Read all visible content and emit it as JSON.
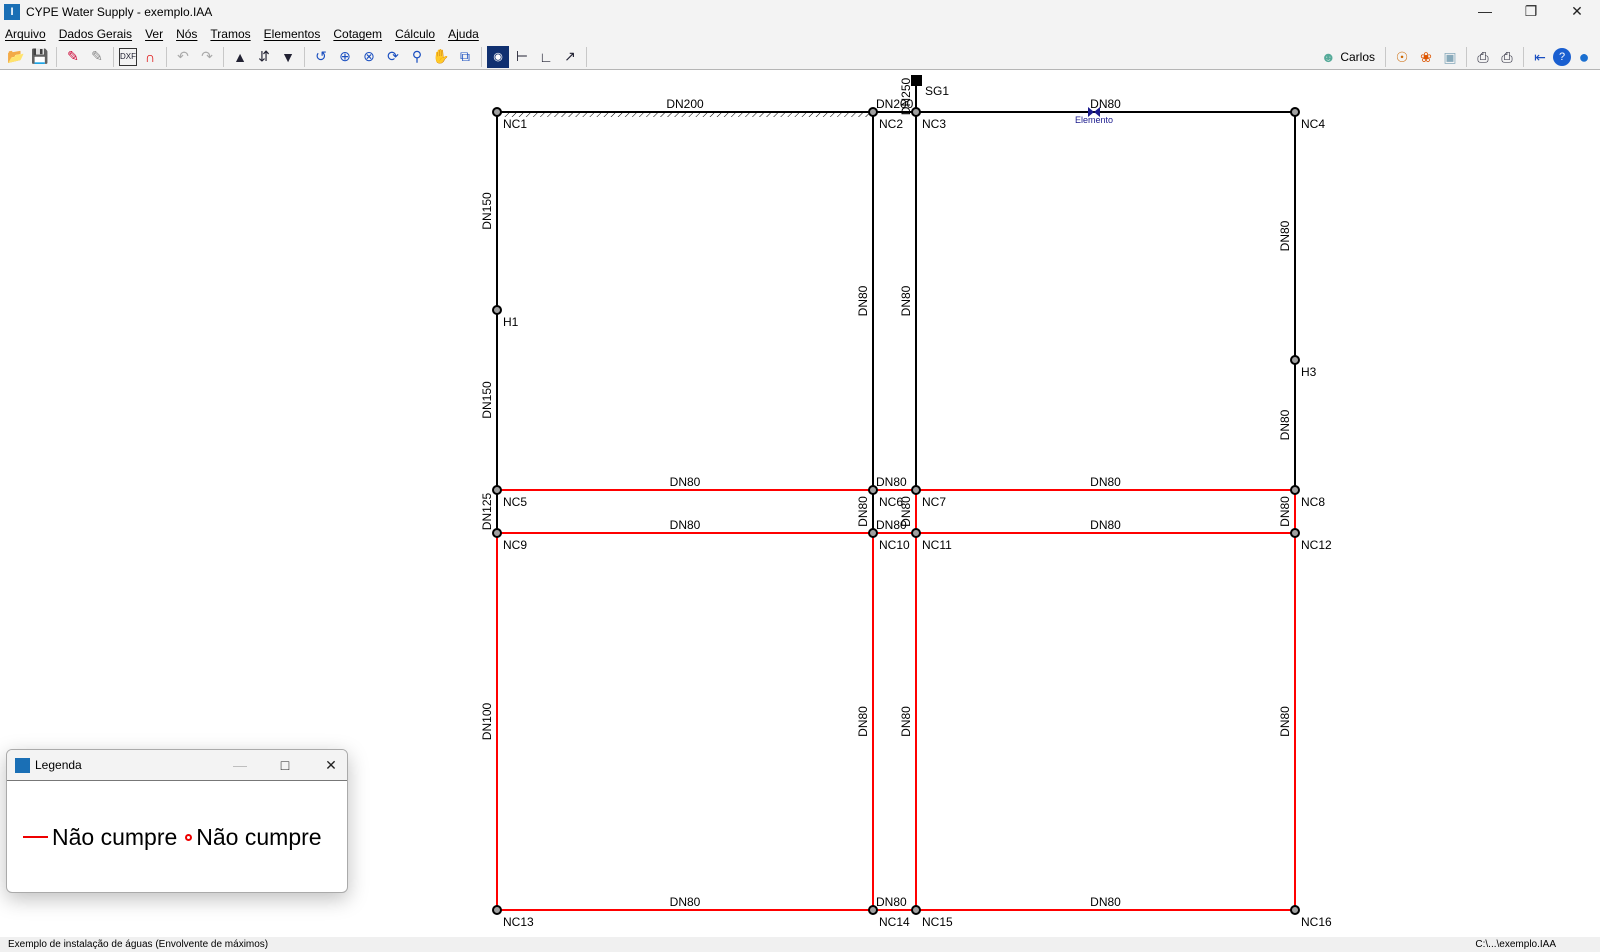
{
  "window": {
    "title": "CYPE Water Supply - exemplo.IAA"
  },
  "menu": [
    "Arquivo",
    "Dados Gerais",
    "Ver",
    "Nós",
    "Tramos",
    "Elementos",
    "Cotagem",
    "Cálculo",
    "Ajuda"
  ],
  "toolbar": {
    "user": "Carlos"
  },
  "colors": {
    "ok": "#000000",
    "fail": "#ff0000",
    "node_fill": "#a0a0a0",
    "element": "#1a1a8c"
  },
  "network": {
    "nodes": [
      "NC1",
      "NC2",
      "NC3",
      "NC4",
      "H1",
      "H3",
      "NC5",
      "NC6",
      "NC7",
      "NC8",
      "NC9",
      "NC10",
      "NC11",
      "NC12",
      "NC13",
      "NC14",
      "NC15",
      "NC16"
    ],
    "source": "SG1",
    "element_label": "Elemento",
    "pipes": [
      {
        "from": "SG1",
        "to": "NC3",
        "label": "DN250",
        "status": "ok"
      },
      {
        "from": "NC1",
        "to": "NC2",
        "label": "DN200",
        "status": "ok",
        "hatched": true
      },
      {
        "from": "NC2",
        "to": "NC3",
        "label": "DN200",
        "status": "ok"
      },
      {
        "from": "NC3",
        "to": "NC4",
        "label": "DN80",
        "status": "ok"
      },
      {
        "from": "NC1",
        "to": "H1",
        "label": "DN150",
        "status": "ok"
      },
      {
        "from": "H1",
        "to": "NC5",
        "label": "DN150",
        "status": "ok"
      },
      {
        "from": "NC5",
        "to": "NC9",
        "label": "DN125",
        "status": "ok"
      },
      {
        "from": "NC2",
        "to": "NC6",
        "label": "DN80",
        "status": "ok"
      },
      {
        "from": "NC3",
        "to": "NC7",
        "label": "DN80",
        "status": "ok"
      },
      {
        "from": "NC4",
        "to": "H3",
        "label": "DN80",
        "status": "ok"
      },
      {
        "from": "H3",
        "to": "NC8",
        "label": "DN80",
        "status": "ok"
      },
      {
        "from": "NC5",
        "to": "NC6",
        "label": "DN80",
        "status": "fail"
      },
      {
        "from": "NC6",
        "to": "NC7",
        "label": "DN80",
        "status": "fail"
      },
      {
        "from": "NC7",
        "to": "NC8",
        "label": "DN80",
        "status": "fail"
      },
      {
        "from": "NC6",
        "to": "NC10",
        "label": "DN80",
        "status": "ok"
      },
      {
        "from": "NC7",
        "to": "NC11",
        "label": "DN80",
        "status": "fail"
      },
      {
        "from": "NC8",
        "to": "NC12",
        "label": "DN80",
        "status": "fail"
      },
      {
        "from": "NC9",
        "to": "NC10",
        "label": "DN80",
        "status": "fail"
      },
      {
        "from": "NC10",
        "to": "NC11",
        "label": "DN80",
        "status": "fail"
      },
      {
        "from": "NC11",
        "to": "NC12",
        "label": "DN80",
        "status": "fail"
      },
      {
        "from": "NC9",
        "to": "NC13",
        "label": "DN100",
        "status": "fail"
      },
      {
        "from": "NC10",
        "to": "NC14",
        "label": "DN80",
        "status": "fail"
      },
      {
        "from": "NC11",
        "to": "NC15",
        "label": "DN80",
        "status": "fail"
      },
      {
        "from": "NC12",
        "to": "NC16",
        "label": "DN80",
        "status": "fail"
      },
      {
        "from": "NC13",
        "to": "NC14",
        "label": "DN80",
        "status": "fail"
      },
      {
        "from": "NC14",
        "to": "NC15",
        "label": "DN80",
        "status": "fail"
      },
      {
        "from": "NC15",
        "to": "NC16",
        "label": "DN80",
        "status": "fail"
      }
    ]
  },
  "legend": {
    "title": "Legenda",
    "pipe_label": "Não cumpre",
    "node_label": "Não cumpre"
  },
  "status": {
    "left": "Exemplo de instalação de águas (Envolvente de máximos)",
    "right": "C:\\...\\exemplo.IAA"
  }
}
